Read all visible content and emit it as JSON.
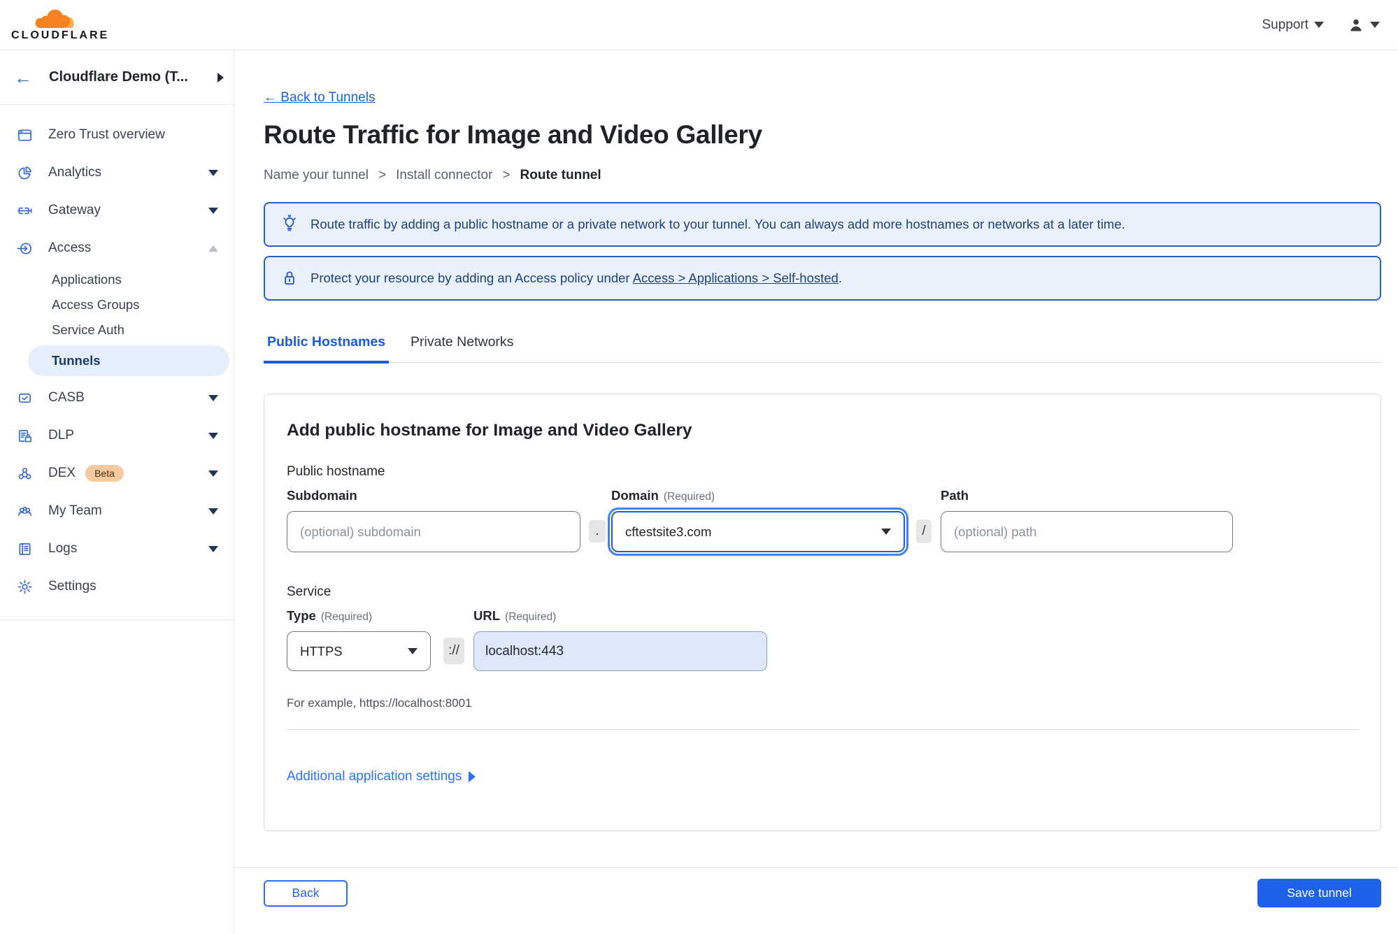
{
  "topbar": {
    "logo_text": "CLOUDFLARE",
    "support_label": "Support"
  },
  "sidebar": {
    "account_name": "Cloudflare Demo (T...",
    "items": [
      {
        "label": "Zero Trust overview"
      },
      {
        "label": "Analytics"
      },
      {
        "label": "Gateway"
      },
      {
        "label": "Access"
      },
      {
        "label": "Applications"
      },
      {
        "label": "Access Groups"
      },
      {
        "label": "Service Auth"
      },
      {
        "label": "Tunnels"
      },
      {
        "label": "CASB"
      },
      {
        "label": "DLP"
      },
      {
        "label": "DEX",
        "badge": "Beta"
      },
      {
        "label": "My Team"
      },
      {
        "label": "Logs"
      },
      {
        "label": "Settings"
      }
    ]
  },
  "main": {
    "back_link": "← Back to Tunnels",
    "title": "Route Traffic for Image and Video Gallery",
    "breadcrumb": {
      "step1": "Name your tunnel",
      "sep1": ">",
      "step2": "Install connector",
      "sep2": ">",
      "step3": "Route tunnel"
    },
    "banners": {
      "route_info": "Route traffic by adding a public hostname or a private network to your tunnel. You can always add more hostnames or networks at a later time.",
      "protect_prefix": "Protect your resource by adding an Access policy under",
      "protect_link": "Access > Applications > Self-hosted",
      "protect_suffix": "."
    },
    "tabs": {
      "public": "Public Hostnames",
      "private": "Private Networks"
    },
    "form": {
      "heading": "Add public hostname for Image and Video Gallery",
      "public_hostname_label": "Public hostname",
      "subdomain_label": "Subdomain",
      "subdomain_placeholder": "(optional) subdomain",
      "dot_separator": ".",
      "domain_label": "Domain",
      "domain_required": "(Required)",
      "domain_value": "cftestsite3.com",
      "slash_separator": "/",
      "path_label": "Path",
      "path_placeholder": "(optional) path",
      "service_label": "Service",
      "type_label": "Type",
      "type_required": "(Required)",
      "type_value": "HTTPS",
      "scheme_separator": "://",
      "url_label": "URL",
      "url_required": "(Required)",
      "url_value": "localhost:443",
      "url_example": "For example, https://localhost:8001",
      "additional_settings": "Additional application settings"
    },
    "footer": {
      "back_label": "Back",
      "save_label": "Save tunnel"
    }
  },
  "colors": {
    "brand_orange": "#f6821f",
    "brand_orange_light": "#fbad41",
    "accent_blue": "#1f62ea",
    "link_blue": "#1f5ed6",
    "banner_border": "#2c5ec9",
    "banner_bg": "#e9f1fc",
    "banner_text": "#20407c",
    "active_pill_bg": "#e5effc",
    "beta_badge_bg": "#f7c9a0",
    "url_autofill_bg": "#dde8fa"
  }
}
